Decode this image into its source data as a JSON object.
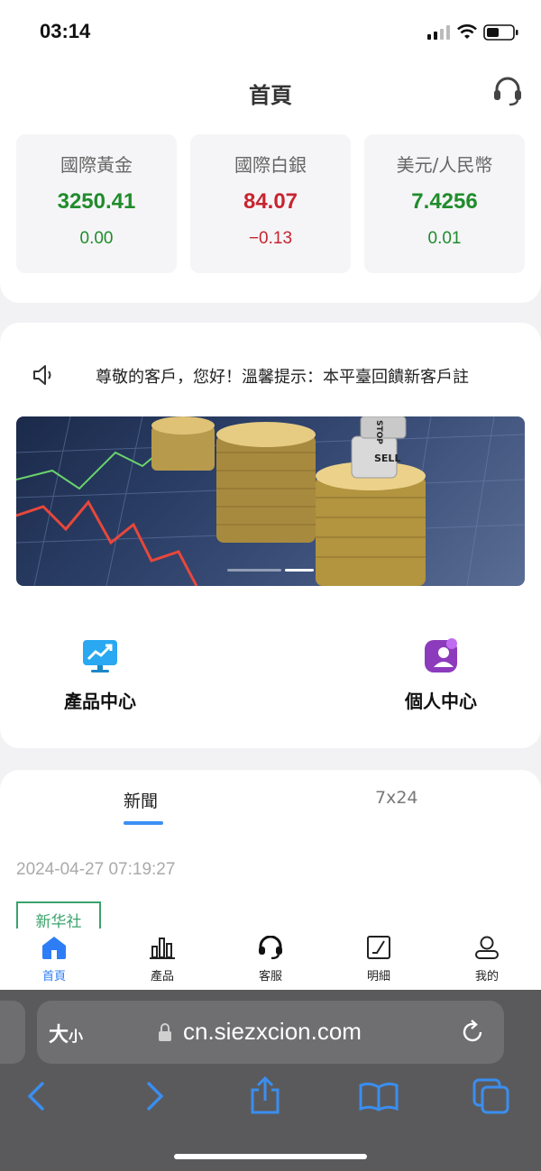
{
  "status_bar": {
    "time": "03:14"
  },
  "header": {
    "title": "首頁",
    "support_icon": "headset-icon"
  },
  "quotes": [
    {
      "name": "國際黃金",
      "price": "3250.41",
      "change": "0.00",
      "color": "#1f8c2b"
    },
    {
      "name": "國際白銀",
      "price": "84.07",
      "change": "−0.13",
      "color": "#c8242f"
    },
    {
      "name": "美元/人民幣",
      "price": "7.4256",
      "change": "0.01",
      "color": "#1f8c2b"
    }
  ],
  "notice": {
    "text": "尊敬的客戶，您好！溫馨提示：本平臺回饋新客戶註"
  },
  "banner": {
    "sign_text": "SELL",
    "dice_text": "STOP",
    "slide_index": 2,
    "slide_count": 2
  },
  "shortcuts": [
    {
      "label": "產品中心",
      "icon": "chart-monitor-icon"
    },
    {
      "label": "個人中心",
      "icon": "user-profile-icon"
    }
  ],
  "news": {
    "tabs": [
      "新聞",
      "7x24"
    ],
    "active_tab": 0,
    "items": [
      {
        "date": "2024-04-27 07:19:27",
        "source": "新华社"
      }
    ]
  },
  "tab_bar": [
    {
      "label": "首頁",
      "icon": "home-icon",
      "active": true
    },
    {
      "label": "產品",
      "icon": "bar-chart-icon",
      "active": false
    },
    {
      "label": "客服",
      "icon": "headset-icon",
      "active": false
    },
    {
      "label": "明細",
      "icon": "details-icon",
      "active": false
    },
    {
      "label": "我的",
      "icon": "user-icon",
      "active": false
    }
  ],
  "browser": {
    "text_size_label": "大",
    "text_size_small": "小",
    "url": "cn.siezxcion.com"
  },
  "colors": {
    "accent": "#2d7df6",
    "up": "#1f8c2b",
    "down": "#c8242f",
    "source_tag": "#3aa36b"
  }
}
